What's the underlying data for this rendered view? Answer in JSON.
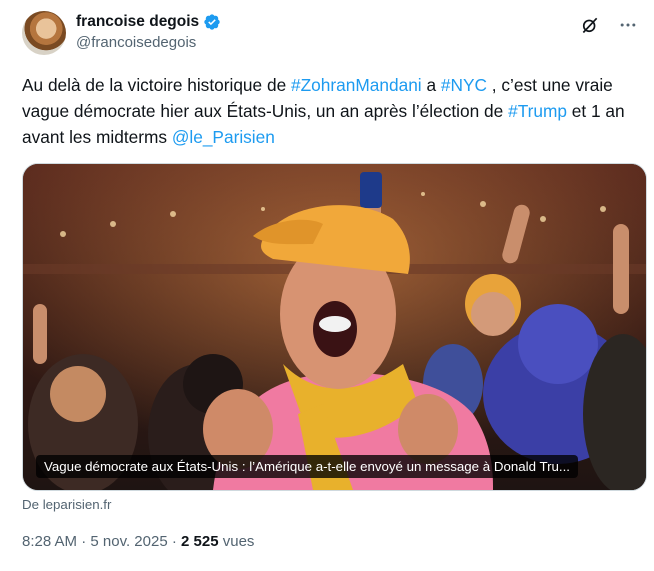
{
  "author": {
    "display_name": "francoise degois",
    "handle": "@francoisedegois",
    "verified": true
  },
  "header": {
    "icons": [
      "grok-icon",
      "more-icon"
    ]
  },
  "tweet": {
    "segments": [
      {
        "text": "Au delà de la victoire historique de ",
        "type": "text"
      },
      {
        "text": "#ZohranMandani",
        "type": "hashtag"
      },
      {
        "text": " a ",
        "type": "text"
      },
      {
        "text": "#NYC",
        "type": "hashtag"
      },
      {
        "text": " , c’est une vraie vague démocrate hier  aux États-Unis, un an après l’élection de ",
        "type": "text"
      },
      {
        "text": "#Trump",
        "type": "hashtag"
      },
      {
        "text": " et 1 an avant les midterms   ",
        "type": "text"
      },
      {
        "text": "@le_Parisien",
        "type": "mention"
      }
    ]
  },
  "card": {
    "caption": "Vague démocrate aux États-Unis : l’Amérique a-t-elle envoyé un message à Donald Tru...",
    "source": "De leparisien.fr"
  },
  "meta": {
    "time": "8:28 AM",
    "separator1": " · ",
    "date": "5 nov. 2025",
    "separator2": " · ",
    "views_count": "2 525",
    "views_label": " vues"
  },
  "colors": {
    "link": "#1d9bf0",
    "verified": "#1d9bf0",
    "muted": "#536471"
  }
}
